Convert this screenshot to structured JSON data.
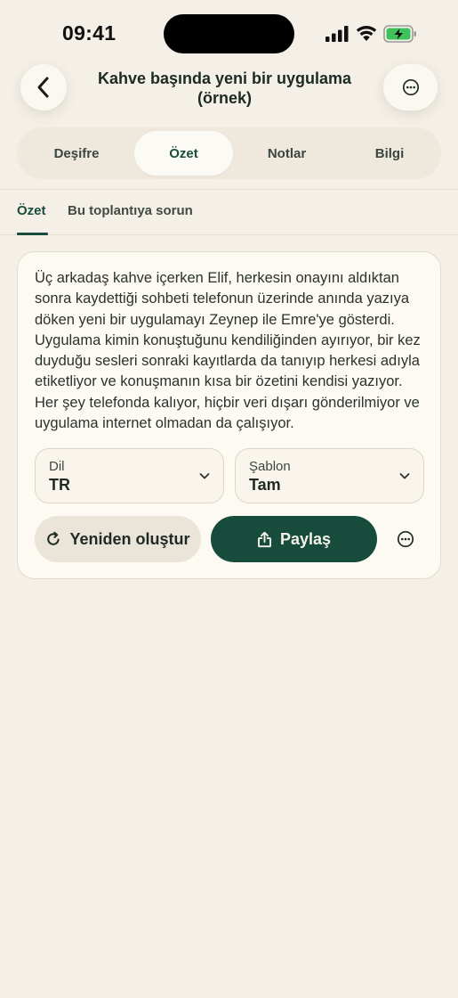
{
  "status_bar": {
    "time": "09:41",
    "icons": [
      "signal-icon",
      "wifi-icon",
      "battery-charging-icon"
    ],
    "battery_color": "#3fc25b"
  },
  "header": {
    "title": "Kahve başında yeni bir uygulama (örnek)",
    "back_icon": "chevron-left-icon",
    "more_icon": "more-horizontal-circle-icon"
  },
  "segmented_tabs": [
    {
      "label": "Deşifre",
      "active": false
    },
    {
      "label": "Özet",
      "active": true
    },
    {
      "label": "Notlar",
      "active": false
    },
    {
      "label": "Bilgi",
      "active": false
    }
  ],
  "sub_tabs": [
    {
      "label": "Özet",
      "active": true
    },
    {
      "label": "Bu toplantıya sorun",
      "active": false
    }
  ],
  "summary": {
    "text": "Üç arkadaş kahve içerken Elif, herkesin onayını aldıktan sonra kaydettiği sohbeti telefonun üzerinde anında yazıya döken yeni bir uygulamayı Zeynep ile Emre'ye gösterdi. Uygulama kimin konuştuğunu kendiliğinden ayırıyor, bir kez duyduğu sesleri sonraki kayıtlarda da tanıyıp herkesi adıyla etiketliyor ve konuşmanın kısa bir özetini kendisi yazıyor. Her şey telefonda kalıyor, hiçbir veri dışarı gönderilmiyor ve uygulama internet olmadan da çalışıyor.",
    "language": {
      "label": "Dil",
      "value": "TR"
    },
    "template": {
      "label": "Şablon",
      "value": "Tam"
    },
    "regenerate_label": "Yeniden oluştur",
    "share_label": "Paylaş"
  },
  "colors": {
    "background": "#f4f0e8",
    "accent": "#174b3b",
    "card": "#fcfaf3"
  }
}
